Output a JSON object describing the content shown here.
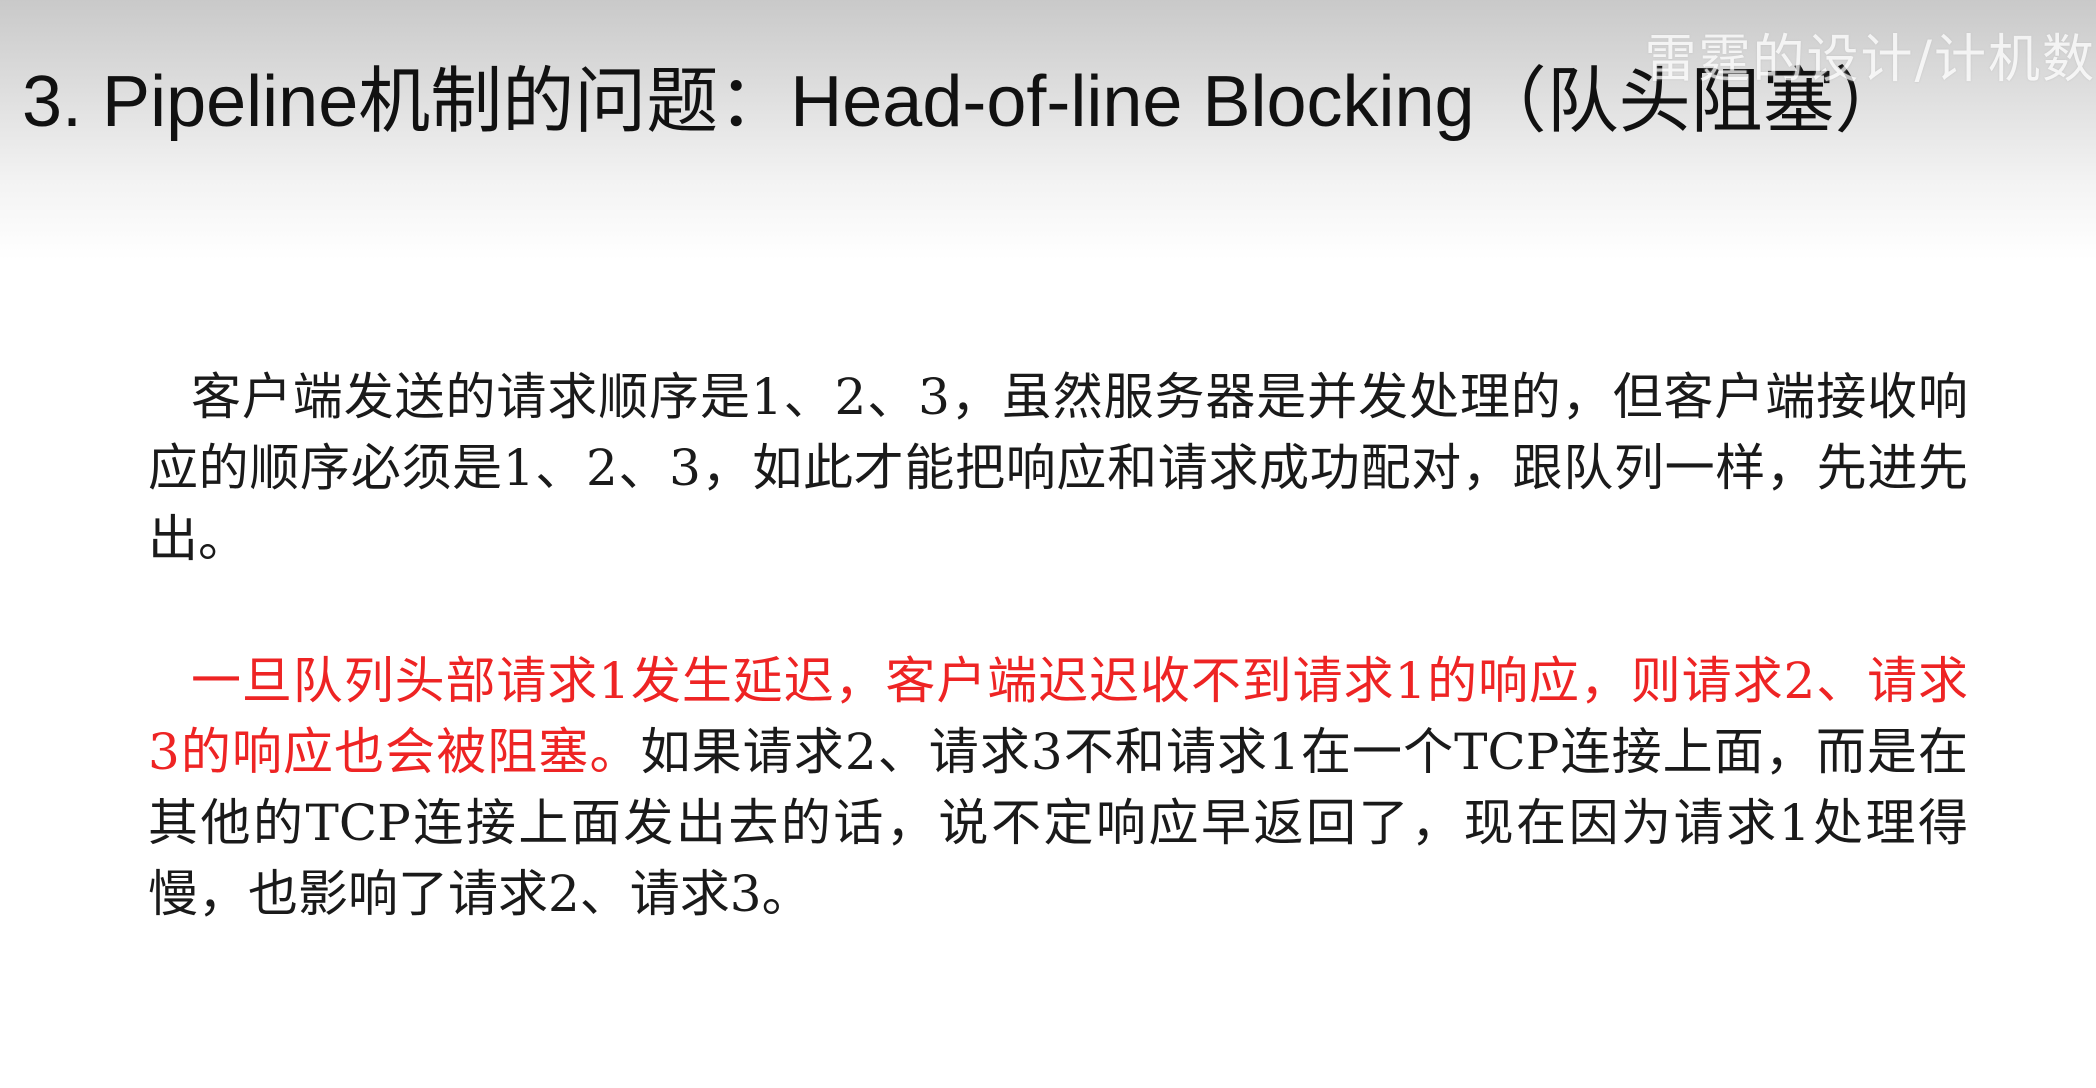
{
  "slide": {
    "title": "3. Pipeline机制的问题：Head-of-line Blocking（队头阻塞）",
    "watermark": "雷霆的设计/计机数",
    "paragraphs": [
      {
        "text": "客户端发送的请求顺序是1、2、3，虽然服务器是并发处理的，但客户端接收响应的顺序必须是1、2、3，如此才能把响应和请求成功配对，跟队列一样，先进先出。"
      },
      {
        "highlight": "一旦队列头部请求1发生延迟，客户端迟迟收不到请求1的响应，则请求2、请求3的响应也会被阻塞。",
        "rest": "如果请求2、请求3不和请求1在一个TCP连接上面，而是在其他的TCP连接上面发出去的话，说不定响应早返回了，现在因为请求1处理得慢，也影响了请求2、请求3。"
      }
    ]
  },
  "colors": {
    "highlight": "#ee2424",
    "body_text": "#1a1a1a",
    "title_text": "#111111"
  }
}
